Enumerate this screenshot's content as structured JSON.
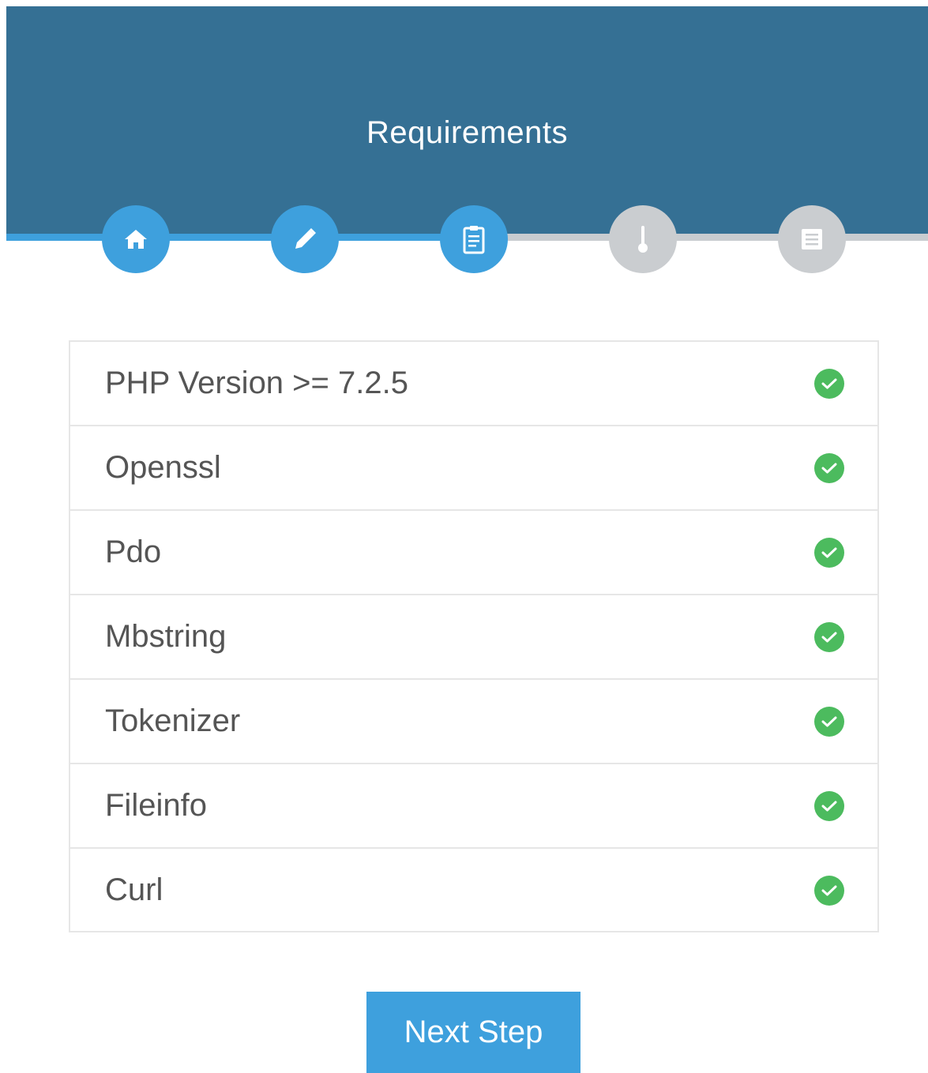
{
  "header": {
    "title": "Requirements"
  },
  "steps": [
    {
      "icon": "home-icon",
      "state": "done"
    },
    {
      "icon": "pencil-icon",
      "state": "done"
    },
    {
      "icon": "clipboard-icon",
      "state": "current"
    },
    {
      "icon": "key-icon",
      "state": "pending"
    },
    {
      "icon": "document-icon",
      "state": "pending"
    }
  ],
  "requirements": [
    {
      "label": "PHP Version >= 7.2.5",
      "status": "check-circle-icon"
    },
    {
      "label": "Openssl",
      "status": "check-circle-icon"
    },
    {
      "label": "Pdo",
      "status": "check-circle-icon"
    },
    {
      "label": "Mbstring",
      "status": "check-circle-icon"
    },
    {
      "label": "Tokenizer",
      "status": "check-circle-icon"
    },
    {
      "label": "Fileinfo",
      "status": "check-circle-icon"
    },
    {
      "label": "Curl",
      "status": "check-circle-icon"
    }
  ],
  "actions": {
    "next_label": "Next Step"
  },
  "colors": {
    "header": "#357094",
    "accent": "#3ea0dd",
    "inactive": "#cacdd0",
    "success": "#4cbb5e"
  }
}
